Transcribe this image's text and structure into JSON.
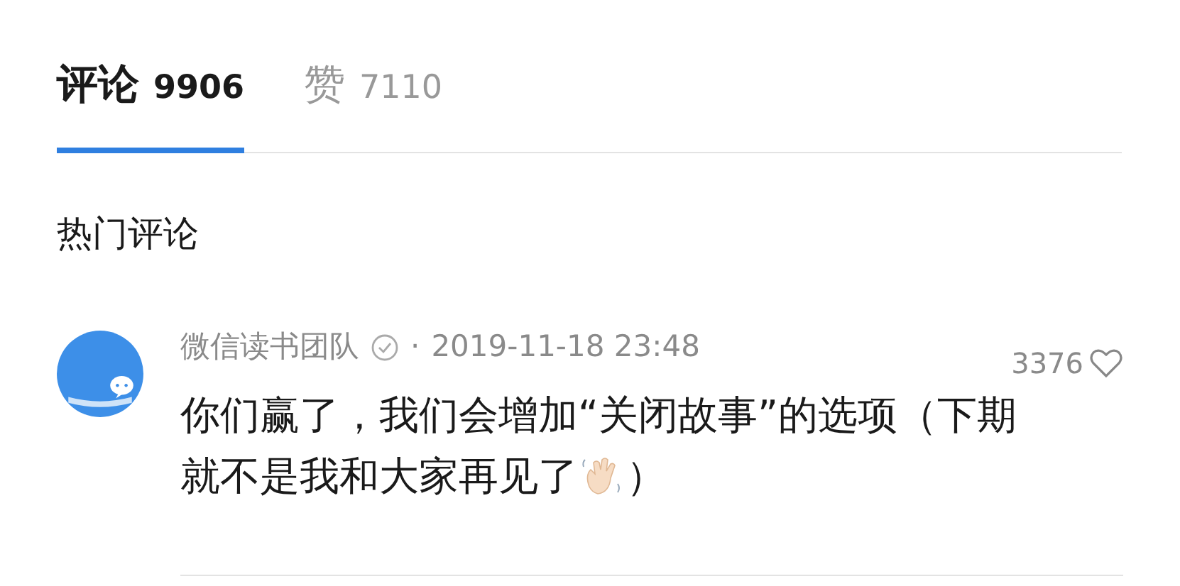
{
  "tabs": [
    {
      "label": "评论",
      "count": "9906",
      "selected": true
    },
    {
      "label": "赞",
      "count": "7110",
      "selected": false
    }
  ],
  "section_title": "热门评论",
  "comments": [
    {
      "author": "微信读书团队",
      "verified": true,
      "separator": "·",
      "time": "2019-11-18 23:48",
      "likes": "3376",
      "liked": false,
      "text_lines": [
        "你们赢了，我们会增加“关闭故事”的选项（下期",
        "就不是我和大家再见了"
      ],
      "text_after": "）"
    }
  ]
}
